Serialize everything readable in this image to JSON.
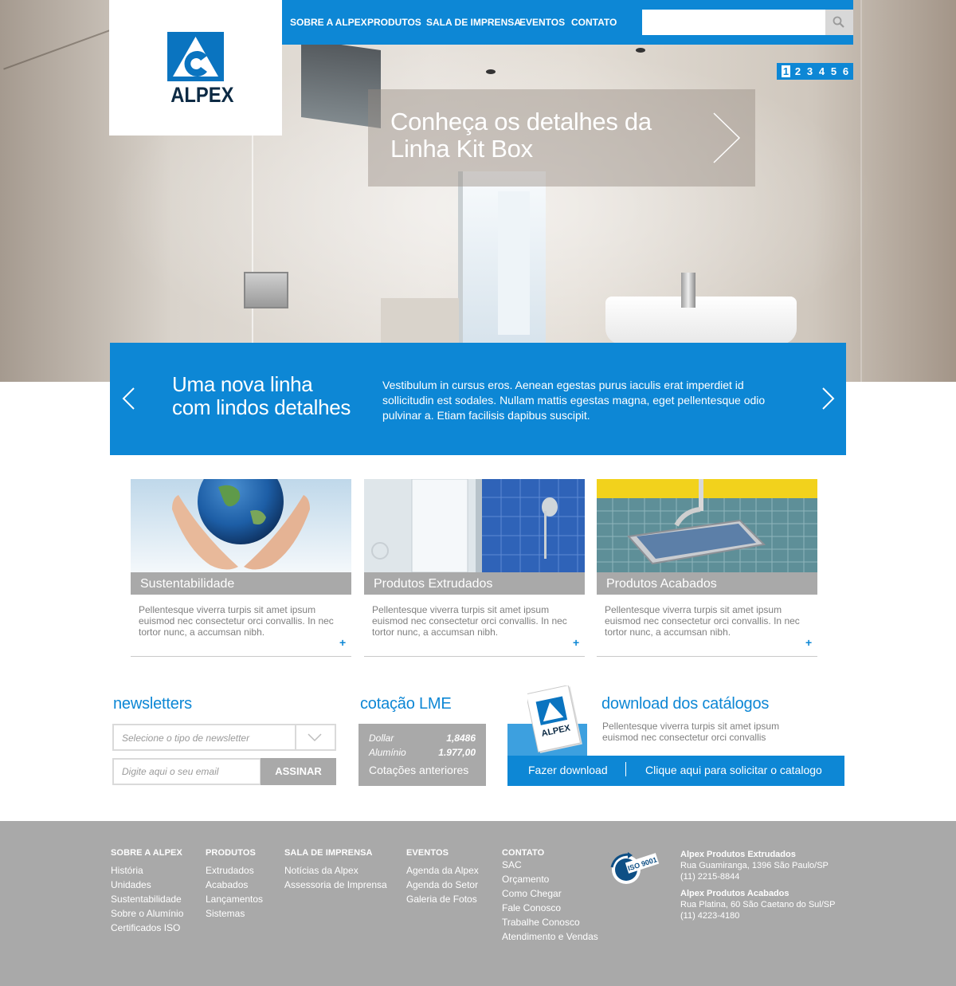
{
  "brand": {
    "logo_text": "ALPEX",
    "accent": "#0d87d5"
  },
  "nav": {
    "home_icon": "home-icon",
    "items": [
      "SOBRE A ALPEX",
      "PRODUTOS",
      "SALA DE IMPRENSA",
      "EVENTOS",
      "CONTATO"
    ],
    "search_placeholder": "",
    "search_icon": "search-icon"
  },
  "slider": {
    "pages": [
      "1",
      "2",
      "3",
      "4",
      "5",
      "6"
    ],
    "active_page": "1",
    "caption_line1": "Conheça os detalhes da",
    "caption_line2": "Linha Kit Box"
  },
  "band": {
    "title_line1": "Uma nova linha",
    "title_line2": "com lindos detalhes",
    "text": "Vestibulum in cursus eros. Aenean egestas purus iaculis erat imperdiet id sollicitudin est sodales. Nullam mattis egestas magna, eget pellentesque odio pulvinar a. Etiam facilisis dapibus suscipit."
  },
  "cards": [
    {
      "title": "Sustentabilidade",
      "text": "Pellentesque viverra turpis sit amet ipsum euismod nec consectetur orci convallis. In nec tortor nunc, a accumsan nibh.",
      "more": "+"
    },
    {
      "title": "Produtos Extrudados",
      "text": "Pellentesque viverra turpis sit amet ipsum euismod nec consectetur orci convallis. In nec tortor nunc, a accumsan nibh.",
      "more": "+"
    },
    {
      "title": "Produtos Acabados",
      "text": "Pellentesque viverra turpis sit amet ipsum euismod nec consectetur orci convallis. In nec tortor nunc, a accumsan nibh.",
      "more": "+"
    }
  ],
  "newsletter": {
    "title": "newsletters",
    "select_value": "Selecione o tipo de newsletter",
    "email_placeholder": "Digite aqui o seu email",
    "button": "ASSINAR"
  },
  "lme": {
    "title": "cotação LME",
    "rows": [
      {
        "label": "Dollar",
        "value": "1,8486"
      },
      {
        "label": "Alumínio",
        "value": "1.977,00"
      }
    ],
    "more": "Cotações anteriores"
  },
  "catalog": {
    "title": "download dos catálogos",
    "text": "Pellentesque viverra turpis sit amet ipsum euismod nec consectetur orci convallis",
    "download_button": "Fazer download",
    "request_button": "Clique aqui para solicitar o catalogo",
    "cover_text": "ALPEX"
  },
  "footer": {
    "columns": [
      {
        "head": "SOBRE A ALPEX",
        "links": [
          "História",
          "Unidades",
          "Sustentabilidade",
          "Sobre o Alumínio",
          "Certificados ISO"
        ]
      },
      {
        "head": "PRODUTOS",
        "links": [
          "Extrudados",
          "Acabados",
          "Lançamentos",
          "Sistemas"
        ]
      },
      {
        "head": "SALA DE IMPRENSA",
        "links": [
          "Notícias da Alpex",
          "Assessoria de Imprensa"
        ]
      },
      {
        "head": "EVENTOS",
        "links": [
          "Agenda da Alpex",
          "Agenda do Setor",
          "Galeria de Fotos"
        ]
      },
      {
        "head": "CONTATO",
        "links": [
          "SAC",
          "Orçamento",
          "Como Chegar",
          "Fale Conosco",
          "Trabalhe Conosco",
          "Atendimento e Vendas"
        ]
      }
    ],
    "iso_label": "ISO 9001",
    "addresses": [
      {
        "name": "Alpex Produtos Extrudados",
        "street": "Rua Guamiranga, 1396 São Paulo/SP",
        "phone": "(11) 2215-8844"
      },
      {
        "name": "Alpex Produtos Acabados",
        "street": "Rua Platina, 60 São Caetano do Sul/SP",
        "phone": "(11) 4223-4180"
      }
    ]
  }
}
